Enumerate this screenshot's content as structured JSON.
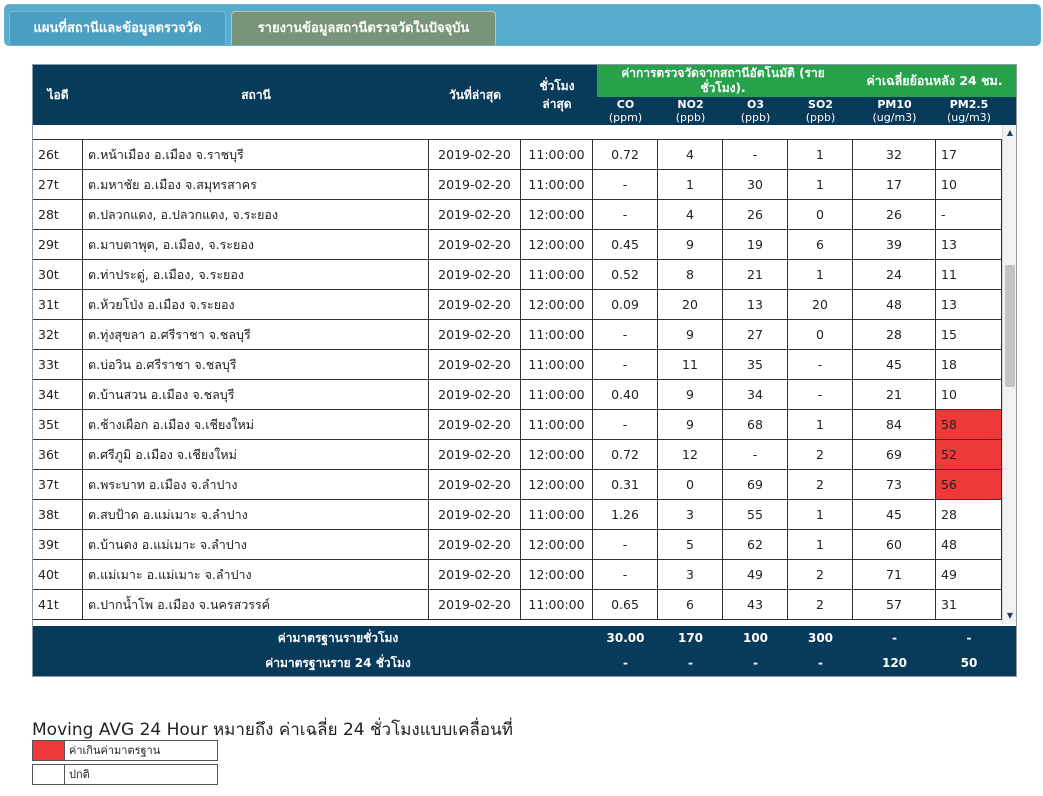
{
  "tabs": [
    {
      "label": "แผนที่สถานีและข้อมูลตรวจวัด"
    },
    {
      "label": "รายงานข้อมูลสถานีตรวจวัดในปัจจุบัน"
    }
  ],
  "table": {
    "headers": {
      "id": "ไอดี",
      "station": "สถานี",
      "date": "วันที่ล่าสุด",
      "time": "ชั่วโมง ล่าสุด",
      "auto_group": "ค่าการตรวจวัดจากสถานีอัตโนมัติ (รายชั่วโมง).",
      "avg_group": "ค่าเฉลี่ยย้อนหลัง 24 ชม."
    },
    "pollutants": [
      {
        "name": "CO",
        "unit": "(ppm)"
      },
      {
        "name": "NO2",
        "unit": "(ppb)"
      },
      {
        "name": "O3",
        "unit": "(ppb)"
      },
      {
        "name": "SO2",
        "unit": "(ppb)"
      },
      {
        "name": "PM10",
        "unit": "(ug/m3)"
      },
      {
        "name": "PM2.5",
        "unit": "(ug/m3)"
      }
    ],
    "rows": [
      {
        "id": "26t",
        "station": "ต.หน้าเมือง อ.เมือง จ.ราชบุรี",
        "date": "2019-02-20",
        "time": "11:00:00",
        "co": "0.72",
        "no2": "4",
        "o3": "-",
        "so2": "1",
        "pm10": "32",
        "pm25": "17",
        "exceed": false
      },
      {
        "id": "27t",
        "station": "ต.มหาชัย อ.เมือง จ.สมุทรสาคร",
        "date": "2019-02-20",
        "time": "11:00:00",
        "co": "-",
        "no2": "1",
        "o3": "30",
        "so2": "1",
        "pm10": "17",
        "pm25": "10",
        "exceed": false
      },
      {
        "id": "28t",
        "station": "ต.ปลวกแดง, อ.ปลวกแดง, จ.ระยอง",
        "date": "2019-02-20",
        "time": "12:00:00",
        "co": "-",
        "no2": "4",
        "o3": "26",
        "so2": "0",
        "pm10": "26",
        "pm25": "-",
        "exceed": false
      },
      {
        "id": "29t",
        "station": "ต.มาบตาพุด, อ.เมือง, จ.ระยอง",
        "date": "2019-02-20",
        "time": "12:00:00",
        "co": "0.45",
        "no2": "9",
        "o3": "19",
        "so2": "6",
        "pm10": "39",
        "pm25": "13",
        "exceed": false
      },
      {
        "id": "30t",
        "station": "ต.ท่าประดู่, อ.เมือง, จ.ระยอง",
        "date": "2019-02-20",
        "time": "11:00:00",
        "co": "0.52",
        "no2": "8",
        "o3": "21",
        "so2": "1",
        "pm10": "24",
        "pm25": "11",
        "exceed": false
      },
      {
        "id": "31t",
        "station": "ต.ห้วยโป่ง อ.เมือง จ.ระยอง",
        "date": "2019-02-20",
        "time": "12:00:00",
        "co": "0.09",
        "no2": "20",
        "o3": "13",
        "so2": "20",
        "pm10": "48",
        "pm25": "13",
        "exceed": false
      },
      {
        "id": "32t",
        "station": "ต.ทุ่งสุขลา อ.ศรีราชา จ.ชลบุรี",
        "date": "2019-02-20",
        "time": "11:00:00",
        "co": "-",
        "no2": "9",
        "o3": "27",
        "so2": "0",
        "pm10": "28",
        "pm25": "15",
        "exceed": false
      },
      {
        "id": "33t",
        "station": "ต.บ่อวิน อ.ศรีราชา จ.ชลบุรี",
        "date": "2019-02-20",
        "time": "11:00:00",
        "co": "-",
        "no2": "11",
        "o3": "35",
        "so2": "-",
        "pm10": "45",
        "pm25": "18",
        "exceed": false
      },
      {
        "id": "34t",
        "station": "ต.บ้านสวน อ.เมือง จ.ชลบุรี",
        "date": "2019-02-20",
        "time": "11:00:00",
        "co": "0.40",
        "no2": "9",
        "o3": "34",
        "so2": "-",
        "pm10": "21",
        "pm25": "10",
        "exceed": false
      },
      {
        "id": "35t",
        "station": "ต.ช้างเผือก อ.เมือง จ.เชียงใหม่",
        "date": "2019-02-20",
        "time": "11:00:00",
        "co": "-",
        "no2": "9",
        "o3": "68",
        "so2": "1",
        "pm10": "84",
        "pm25": "58",
        "exceed": true
      },
      {
        "id": "36t",
        "station": "ต.ศรีภูมิ อ.เมือง จ.เชียงใหม่",
        "date": "2019-02-20",
        "time": "12:00:00",
        "co": "0.72",
        "no2": "12",
        "o3": "-",
        "so2": "2",
        "pm10": "69",
        "pm25": "52",
        "exceed": true
      },
      {
        "id": "37t",
        "station": "ต.พระบาท อ.เมือง จ.ลำปาง",
        "date": "2019-02-20",
        "time": "12:00:00",
        "co": "0.31",
        "no2": "0",
        "o3": "69",
        "so2": "2",
        "pm10": "73",
        "pm25": "56",
        "exceed": true
      },
      {
        "id": "38t",
        "station": "ต.สบป้าด อ.แม่เมาะ จ.ลำปาง",
        "date": "2019-02-20",
        "time": "11:00:00",
        "co": "1.26",
        "no2": "3",
        "o3": "55",
        "so2": "1",
        "pm10": "45",
        "pm25": "28",
        "exceed": false
      },
      {
        "id": "39t",
        "station": "ต.บ้านดง อ.แม่เมาะ จ.ลำปาง",
        "date": "2019-02-20",
        "time": "12:00:00",
        "co": "-",
        "no2": "5",
        "o3": "62",
        "so2": "1",
        "pm10": "60",
        "pm25": "48",
        "exceed": false
      },
      {
        "id": "40t",
        "station": "ต.แม่เมาะ อ.แม่เมาะ จ.ลำปาง",
        "date": "2019-02-20",
        "time": "12:00:00",
        "co": "-",
        "no2": "3",
        "o3": "49",
        "so2": "2",
        "pm10": "71",
        "pm25": "49",
        "exceed": false
      },
      {
        "id": "41t",
        "station": "ต.ปากน้ำโพ อ.เมือง จ.นครสวรรค์",
        "date": "2019-02-20",
        "time": "11:00:00",
        "co": "0.65",
        "no2": "6",
        "o3": "43",
        "so2": "2",
        "pm10": "57",
        "pm25": "31",
        "exceed": false
      }
    ],
    "footer": [
      {
        "label": "ค่ามาตรฐานรายชั่วโมง",
        "values": [
          "30.00",
          "170",
          "100",
          "300",
          "-",
          "-"
        ]
      },
      {
        "label": "ค่ามาตรฐานราย 24 ชั่วโมง",
        "values": [
          "-",
          "-",
          "-",
          "-",
          "120",
          "50"
        ]
      }
    ]
  },
  "legend": {
    "title": "Moving AVG 24 Hour หมายถึง ค่าเฉลี่ย 24 ชั่วโมงแบบเคลื่อนที่",
    "items": [
      {
        "label": "ค่าเกินค่ามาตรฐาน",
        "color": "#f03a3a"
      },
      {
        "label": "ปกติ",
        "color": "#ffffff"
      }
    ]
  },
  "colors": {
    "header_bg": "#083a5a",
    "group_header_bg": "#27a14a",
    "exceed": "#f03a3a",
    "tab_bar": "#5aaccd",
    "active_tab": "#7a9479"
  }
}
